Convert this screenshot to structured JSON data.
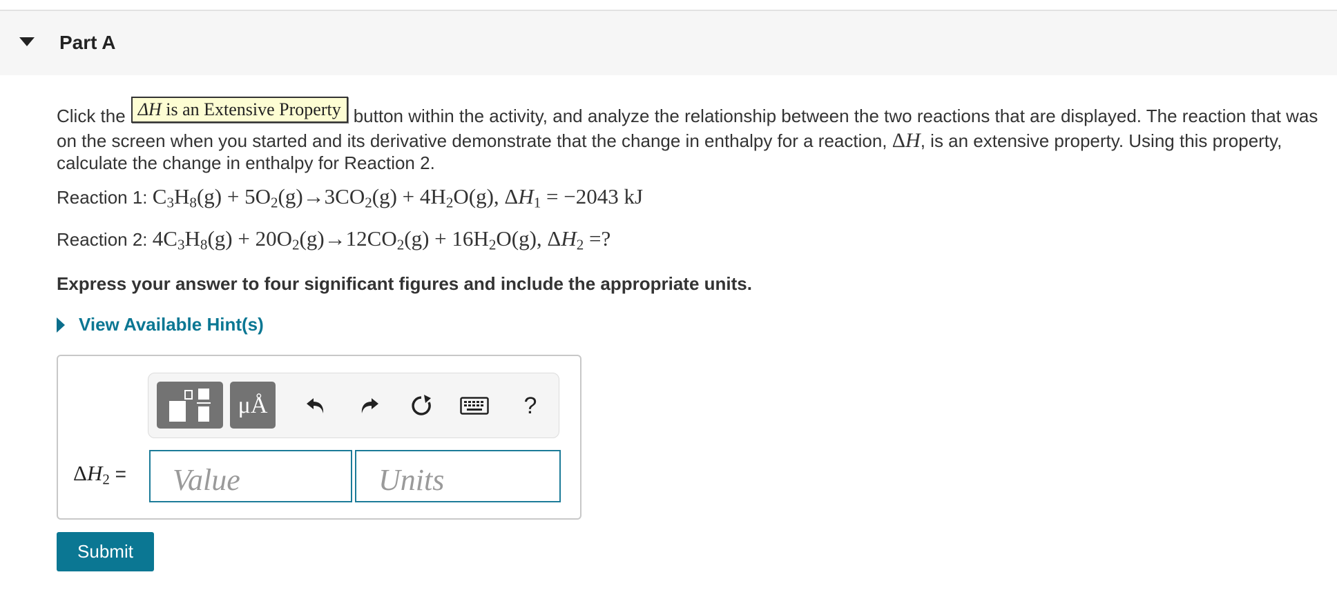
{
  "header": {
    "title": "Part A"
  },
  "question": {
    "intro_prefix": "Click the",
    "activity_button_label": "ΔH is an Extensive Property",
    "intro_suffix": "button within the activity, and analyze the relationship between the two reactions that are displayed. The reaction that was on the screen when you started and its derivative demonstrate that the change in enthalpy for a reaction,",
    "intro_tail": ", is an extensive property. Using this property, calculate the change in enthalpy for Reaction 2.",
    "reaction1_label": "Reaction 1:",
    "reaction1_delta_value": "−2043 kJ",
    "reaction2_label": "Reaction 2:",
    "reaction2_delta_value": "?",
    "instruction": "Express your answer to four significant figures and include the appropriate units."
  },
  "hints": {
    "label": "View Available Hint(s)"
  },
  "toolbar": {
    "units_label": "μÅ",
    "help_label": "?",
    "icons": [
      "templates-icon",
      "units-icon",
      "undo-icon",
      "redo-icon",
      "reset-icon",
      "keyboard-icon",
      "help-icon"
    ]
  },
  "answer": {
    "variable_suffix": "=",
    "value_placeholder": "Value",
    "units_placeholder": "Units"
  },
  "submit": {
    "label": "Submit"
  },
  "colors": {
    "accent": "#0b7793",
    "activity_button_bg": "#fdfdd3",
    "toolbar_button": "#737373"
  }
}
